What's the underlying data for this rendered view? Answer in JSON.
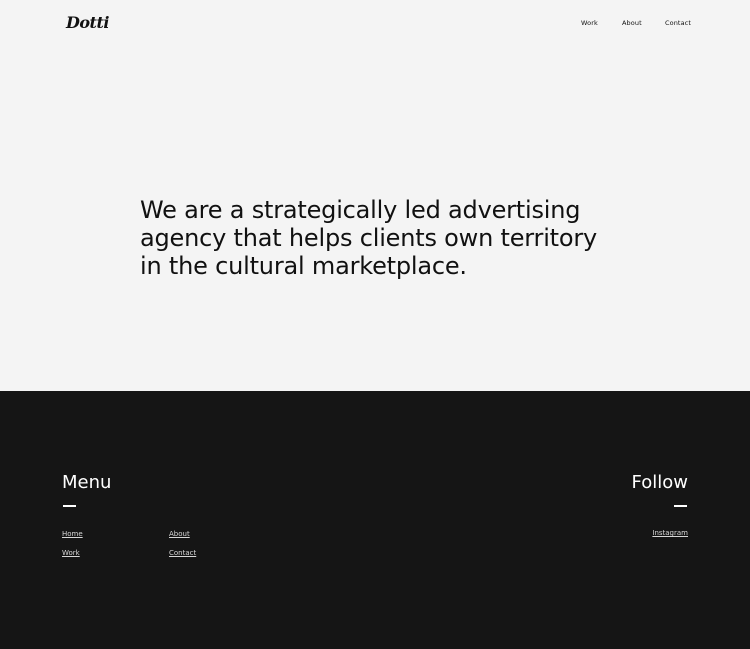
{
  "brand": {
    "logo_text": "Dotti"
  },
  "nav": {
    "items": [
      {
        "label": "Work"
      },
      {
        "label": "About"
      },
      {
        "label": "Contact"
      }
    ]
  },
  "hero": {
    "text": "We are a strategically led advertising agency that helps clients own territory in the cultural marketplace."
  },
  "footer": {
    "menu_title": "Menu",
    "follow_title": "Follow",
    "menu_links": [
      {
        "label": "Home"
      },
      {
        "label": "Work"
      },
      {
        "label": "About"
      },
      {
        "label": "Contact"
      }
    ],
    "follow_links": [
      {
        "label": "Instagram"
      }
    ]
  },
  "colors": {
    "page_background": "#f4f4f4",
    "footer_background": "#151515",
    "text_dark": "#111111",
    "text_light": "#ffffff"
  }
}
